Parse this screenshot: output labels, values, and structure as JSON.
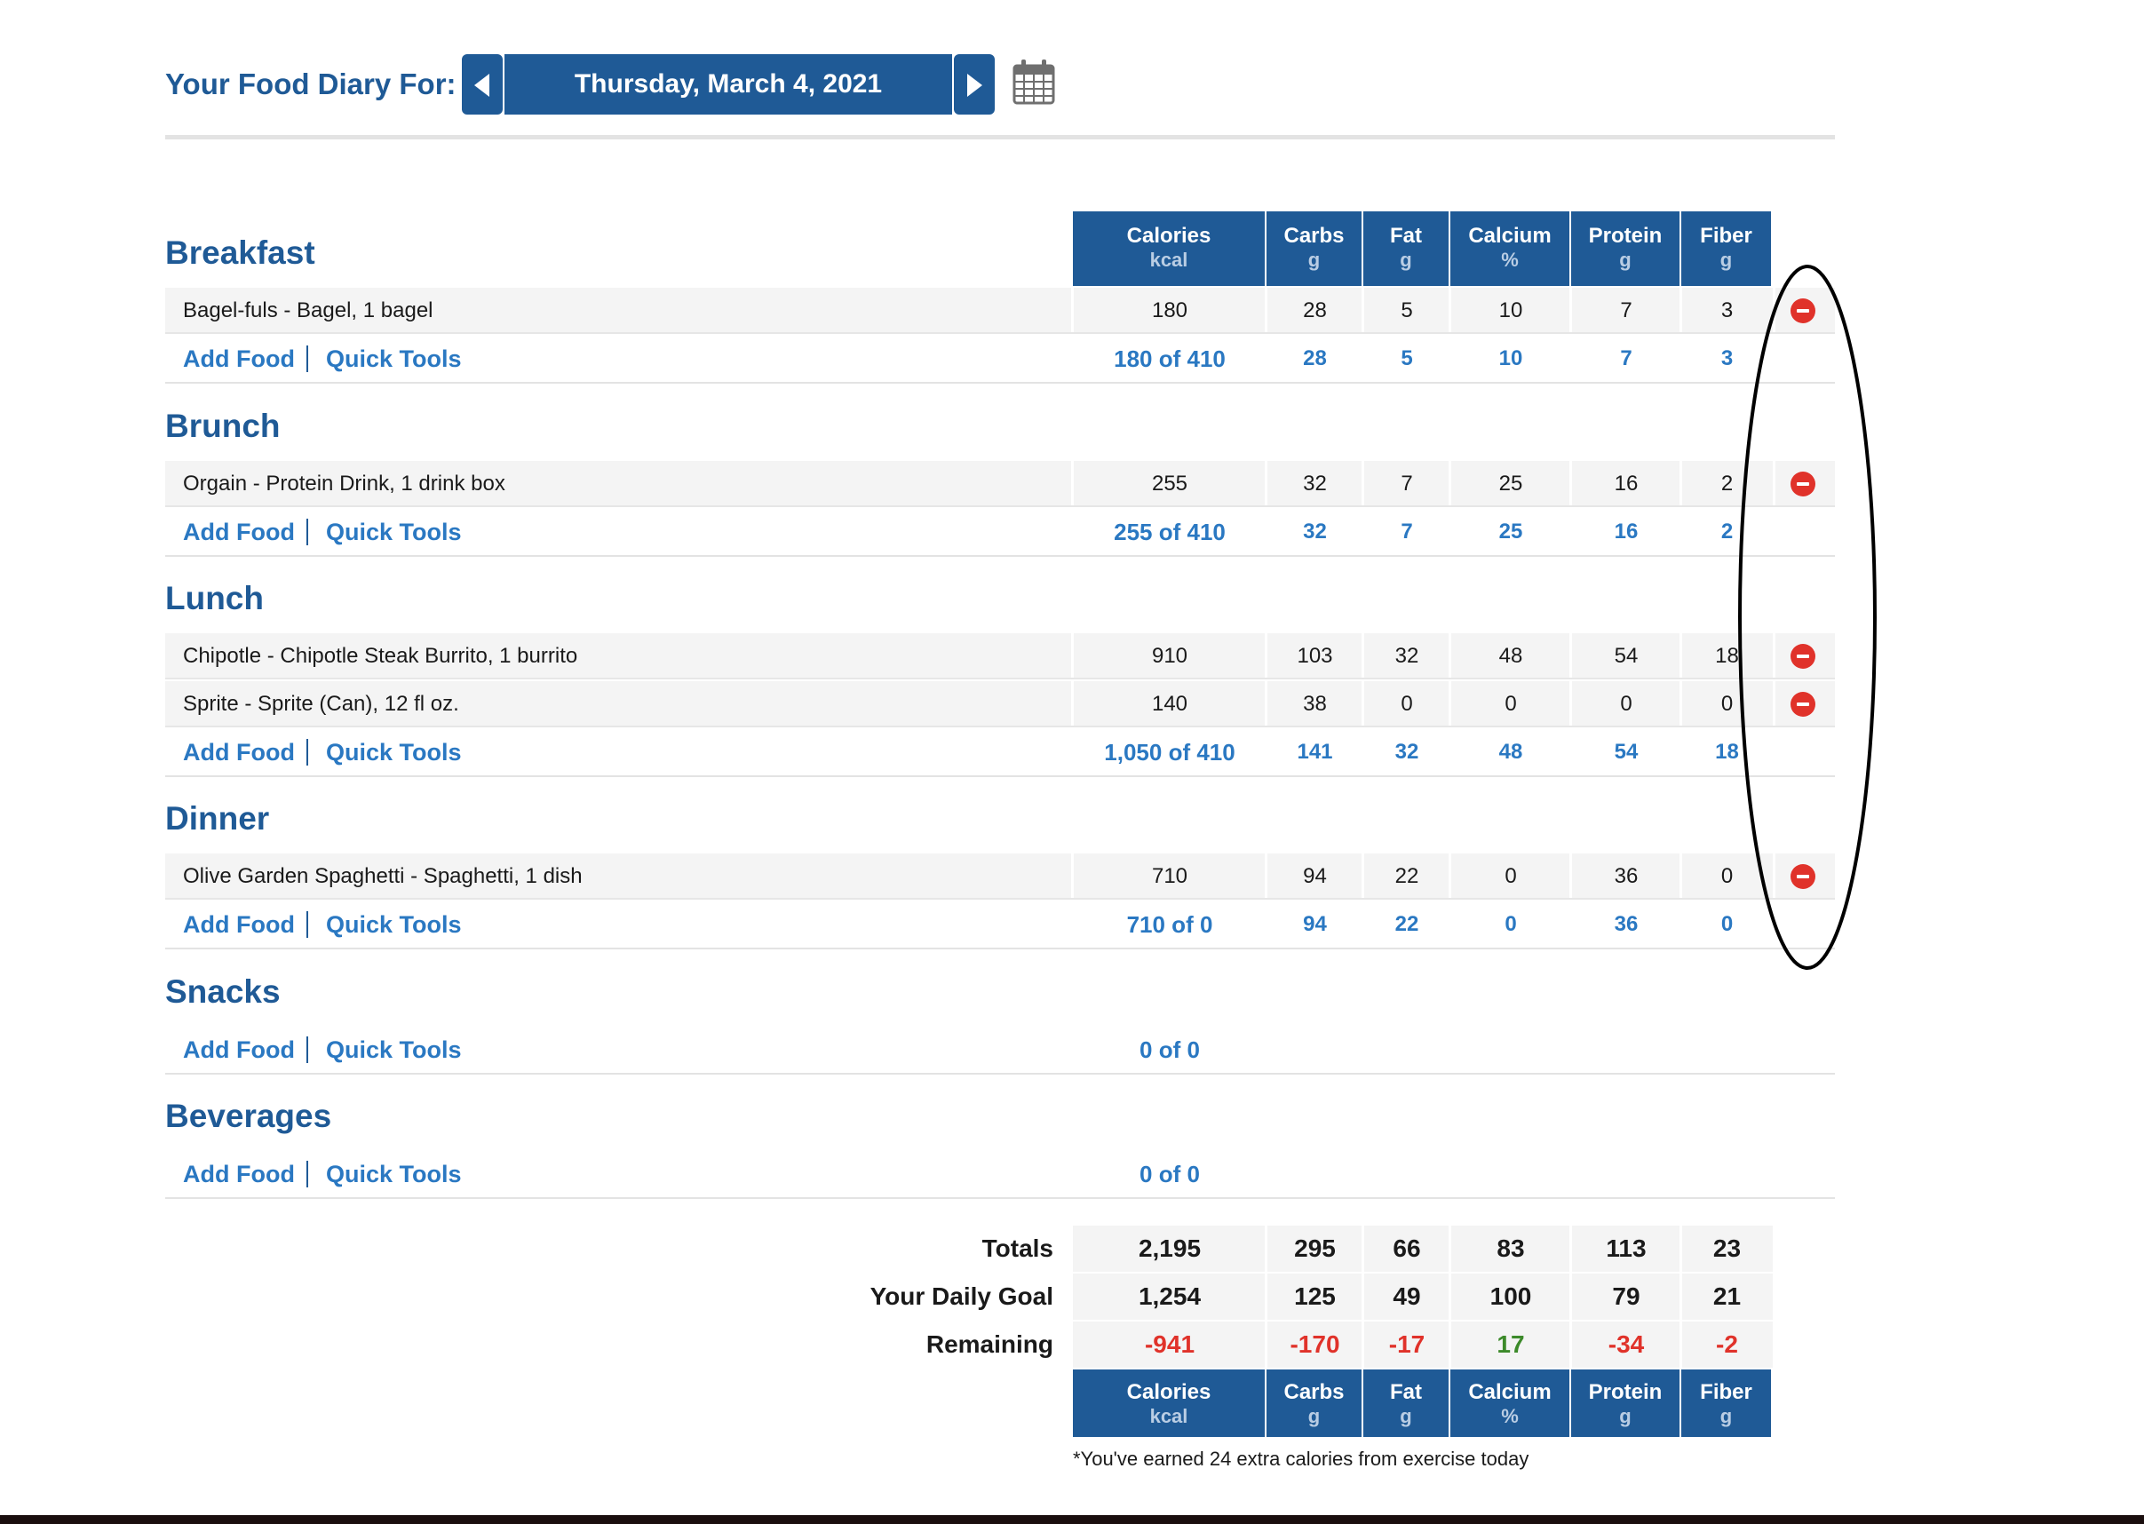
{
  "header": {
    "label": "Your Food Diary For:",
    "date": "Thursday, March 4, 2021"
  },
  "columns": [
    {
      "name": "Calories",
      "unit": "kcal"
    },
    {
      "name": "Carbs",
      "unit": "g"
    },
    {
      "name": "Fat",
      "unit": "g"
    },
    {
      "name": "Calcium",
      "unit": "%"
    },
    {
      "name": "Protein",
      "unit": "g"
    },
    {
      "name": "Fiber",
      "unit": "g"
    }
  ],
  "links": {
    "add_food": "Add Food",
    "quick_tools": "Quick Tools"
  },
  "meals": [
    {
      "title": "Breakfast",
      "entries": [
        {
          "food": "Bagel-fuls - Bagel, 1 bagel",
          "values": [
            "180",
            "28",
            "5",
            "10",
            "7",
            "3"
          ]
        }
      ],
      "summary": [
        "180 of 410",
        "28",
        "5",
        "10",
        "7",
        "3"
      ]
    },
    {
      "title": "Brunch",
      "entries": [
        {
          "food": "Orgain - Protein Drink, 1 drink box",
          "values": [
            "255",
            "32",
            "7",
            "25",
            "16",
            "2"
          ]
        }
      ],
      "summary": [
        "255 of 410",
        "32",
        "7",
        "25",
        "16",
        "2"
      ]
    },
    {
      "title": "Lunch",
      "entries": [
        {
          "food": "Chipotle - Chipotle Steak Burrito, 1 burrito",
          "values": [
            "910",
            "103",
            "32",
            "48",
            "54",
            "18"
          ]
        },
        {
          "food": "Sprite - Sprite (Can), 12 fl oz.",
          "values": [
            "140",
            "38",
            "0",
            "0",
            "0",
            "0"
          ]
        }
      ],
      "summary": [
        "1,050 of 410",
        "141",
        "32",
        "48",
        "54",
        "18"
      ]
    },
    {
      "title": "Dinner",
      "entries": [
        {
          "food": "Olive Garden Spaghetti - Spaghetti, 1 dish",
          "values": [
            "710",
            "94",
            "22",
            "0",
            "36",
            "0"
          ]
        }
      ],
      "summary": [
        "710 of 0",
        "94",
        "22",
        "0",
        "36",
        "0"
      ]
    },
    {
      "title": "Snacks",
      "entries": [],
      "summary": [
        "0 of 0"
      ]
    },
    {
      "title": "Beverages",
      "entries": [],
      "summary": [
        "0 of 0"
      ]
    }
  ],
  "totals": {
    "rows": [
      {
        "label": "Totals",
        "values": [
          "2,195",
          "295",
          "66",
          "83",
          "113",
          "23"
        ]
      },
      {
        "label": "Your Daily Goal",
        "values": [
          "1,254",
          "125",
          "49",
          "100",
          "79",
          "21"
        ]
      },
      {
        "label": "Remaining",
        "values": [
          "-941",
          "-170",
          "-17",
          "17",
          "-34",
          "-2"
        ],
        "status": [
          "neg",
          "neg",
          "neg",
          "pos",
          "neg",
          "neg"
        ]
      }
    ]
  },
  "footnote": "*You've earned 24 extra calories from exercise today",
  "colors": {
    "brand_blue": "#1f5a96",
    "link_blue": "#2a78c2",
    "remove_red": "#e0322a",
    "positive_green": "#3c8a2a"
  },
  "icons": {
    "prev": "left-triangle-icon",
    "next": "right-triangle-icon",
    "calendar": "calendar-icon",
    "remove": "remove-circle-icon"
  }
}
